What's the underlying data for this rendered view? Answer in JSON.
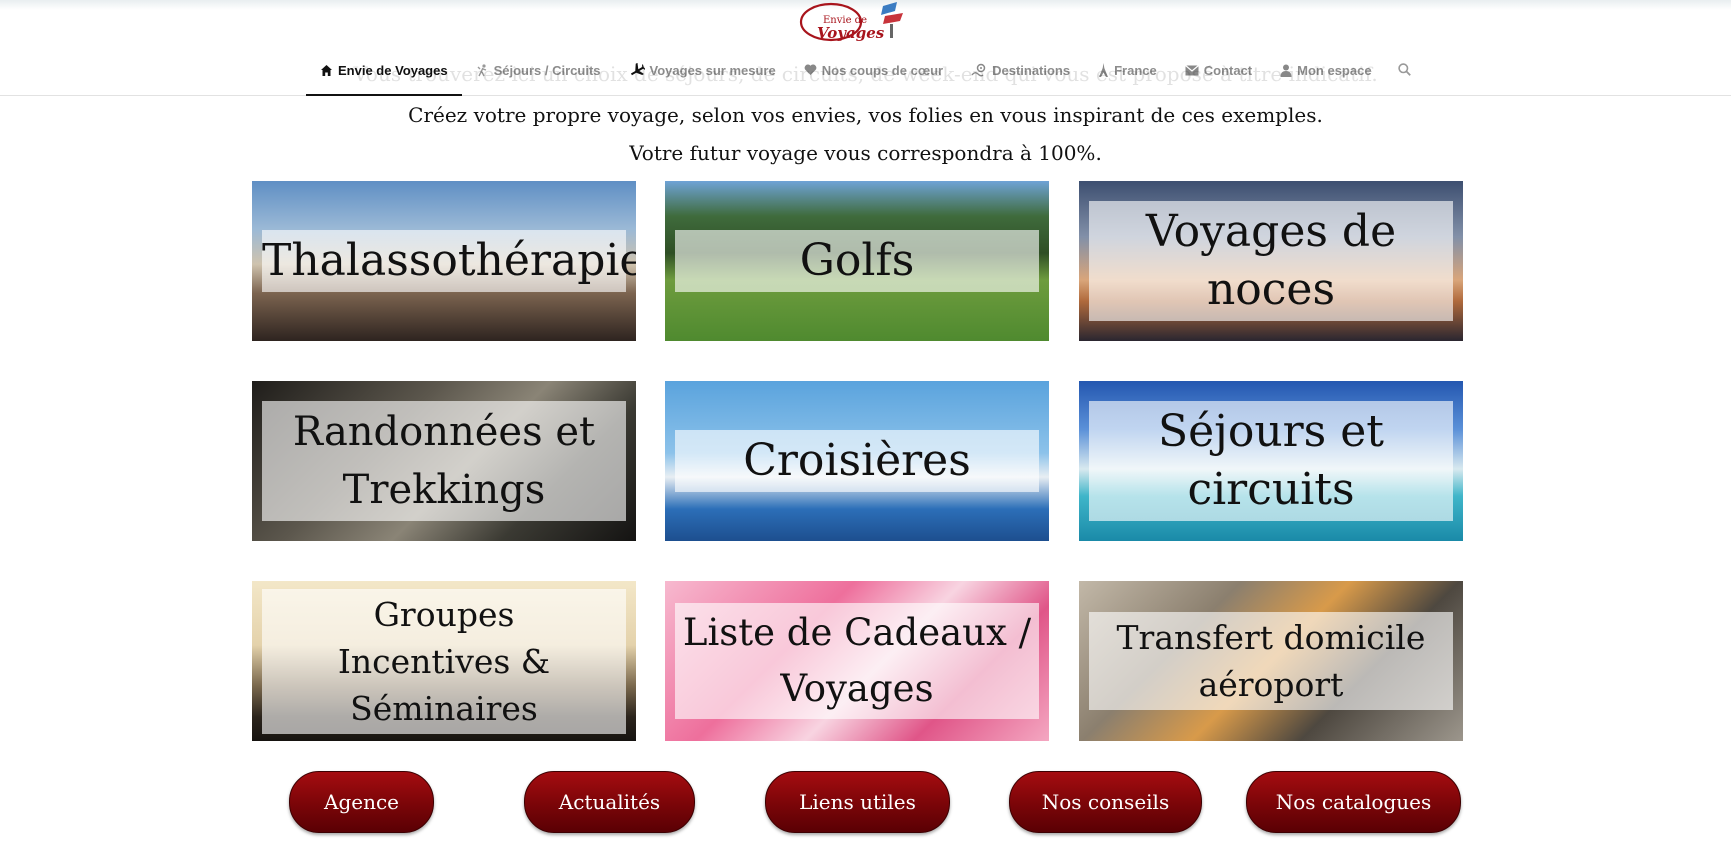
{
  "brand": {
    "logo_small": "Envie de",
    "logo_big": "Voyages"
  },
  "nav": {
    "items": [
      {
        "label": "Envie de Voyages",
        "icon": "home-icon",
        "active": true
      },
      {
        "label": "Séjours / Circuits",
        "icon": "hiker-icon",
        "active": false
      },
      {
        "label": "Voyages sur mesure",
        "icon": "plane-icon",
        "active": false
      },
      {
        "label": "Nos coups de cœur",
        "icon": "heart-icon",
        "active": false
      },
      {
        "label": "Destinations",
        "icon": "map-pin-icon",
        "active": false
      },
      {
        "label": "France",
        "icon": "eiffel-tower-icon",
        "active": false
      },
      {
        "label": "Contact",
        "icon": "envelope-icon",
        "active": false
      },
      {
        "label": "Mon espace",
        "icon": "user-icon",
        "active": false
      }
    ],
    "search_icon": "search-icon"
  },
  "intro": {
    "ghost_line": "Vous trouverez ici un choix de séjours, de circuits, de week-end qui vous est proposé à titre indicatif.",
    "line1": "Créez votre propre voyage, selon vos envies, vos folies en vous inspirant de ces exemples.",
    "line2": "Votre futur voyage vous correspondra à 100%."
  },
  "tiles": [
    {
      "lines": [
        "Thalassothérapie"
      ]
    },
    {
      "lines": [
        "Golfs"
      ]
    },
    {
      "lines": [
        "Voyages de noces"
      ]
    },
    {
      "lines": [
        "Randonnées et",
        "Trekkings"
      ]
    },
    {
      "lines": [
        "Croisières"
      ]
    },
    {
      "lines": [
        "Séjours et circuits"
      ]
    },
    {
      "lines": [
        "Groupes",
        "Incentives & Séminaires"
      ]
    },
    {
      "lines": [
        "Liste de Cadeaux /",
        "Voyages"
      ]
    },
    {
      "lines": [
        "Transfert domicile",
        "aéroport"
      ]
    }
  ],
  "buttons": [
    {
      "label": "Agence"
    },
    {
      "label": "Actualités"
    },
    {
      "label": "Liens utiles"
    },
    {
      "label": "Nos conseils"
    },
    {
      "label": "Nos catalogues"
    }
  ],
  "colors": {
    "button_red": "#7a0508",
    "logo_red": "#a8141c",
    "nav_active": "#111111",
    "nav_inactive": "#8c8c8c"
  }
}
